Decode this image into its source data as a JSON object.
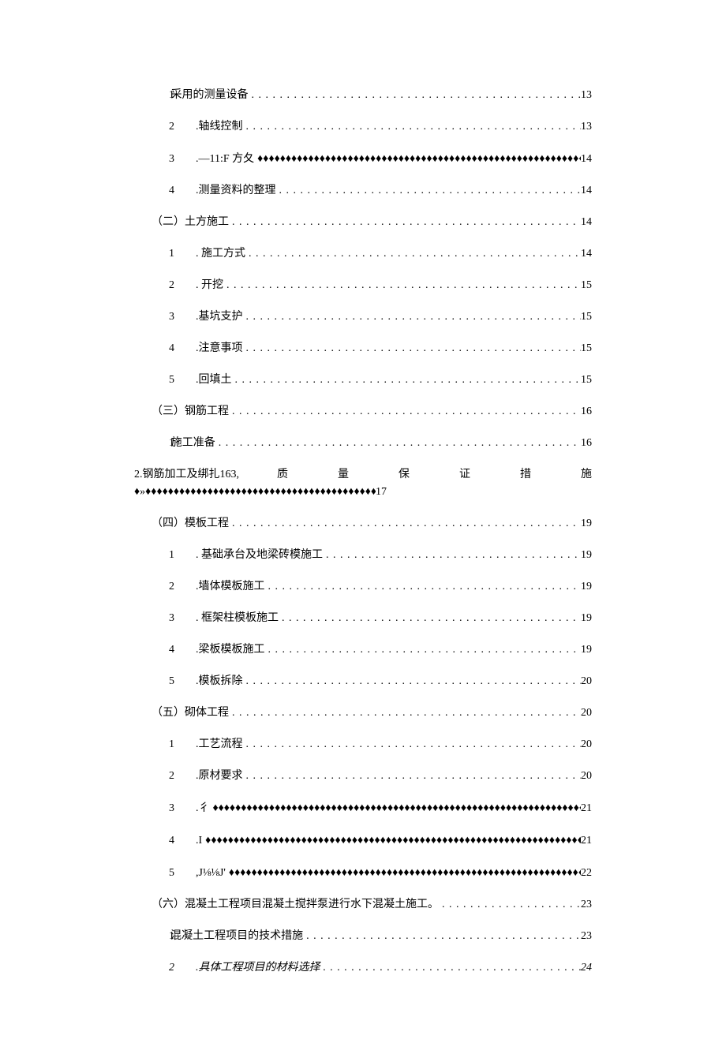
{
  "toc": {
    "items": [
      {
        "indent": 1,
        "num": "1",
        "label": "采用的测量设备",
        "fill": "dot",
        "page": "13",
        "numstyle": "wide"
      },
      {
        "indent": 1,
        "num": "2",
        "label": ".轴线控制",
        "fill": "dot",
        "page": "13"
      },
      {
        "indent": 1,
        "num": "3",
        "label": ".—11:F 方夂",
        "fill": "diamond",
        "page": "14"
      },
      {
        "indent": 1,
        "num": "4",
        "label": ".测量资料的整理",
        "fill": "dot",
        "page": "14"
      },
      {
        "indent": 2,
        "num": "",
        "label": "（二）土方施工",
        "fill": "dot",
        "page": "14",
        "numstyle": "wide"
      },
      {
        "indent": 1,
        "num": "1",
        "label": ". 施工方式",
        "fill": "dot",
        "page": "14"
      },
      {
        "indent": 1,
        "num": "2",
        "label": ". 开挖",
        "fill": "dot",
        "page": "15"
      },
      {
        "indent": 1,
        "num": "3",
        "label": ".基坑支护",
        "fill": "dot",
        "page": "15"
      },
      {
        "indent": 1,
        "num": "4",
        "label": ".注意事项",
        "fill": "dot",
        "page": "15"
      },
      {
        "indent": 1,
        "num": "5",
        "label": ".回填土",
        "fill": "dot",
        "page": "15"
      },
      {
        "indent": 2,
        "num": "",
        "label": "（三）钢筋工程",
        "fill": "dot",
        "page": "16",
        "numstyle": "wide"
      },
      {
        "indent": 1,
        "num": "1",
        "label": "施工准备",
        "fill": "dot",
        "page": "16",
        "numstyle": "wide"
      }
    ],
    "block": {
      "prefix": "2.钢筋加工及绑扎163,",
      "spread": "质量保证措施",
      "prefix2": "♦»",
      "page": "17"
    },
    "items2": [
      {
        "indent": 2,
        "num": "",
        "label": "（四）模板工程",
        "fill": "dot",
        "page": "19",
        "numstyle": "wide"
      },
      {
        "indent": 1,
        "num": "1",
        "label": ". 基础承台及地梁砖模施工",
        "fill": "dot",
        "page": "19"
      },
      {
        "indent": 1,
        "num": "2",
        "label": ".墙体模板施工",
        "fill": "dot",
        "page": "19"
      },
      {
        "indent": 1,
        "num": "3",
        "label": ". 框架柱模板施工",
        "fill": "dot",
        "page": "19"
      },
      {
        "indent": 1,
        "num": "4",
        "label": ".梁板模板施工",
        "fill": "dot",
        "page": "19"
      },
      {
        "indent": 1,
        "num": "5",
        "label": ".模板拆除",
        "fill": "dot",
        "page": "20"
      },
      {
        "indent": 2,
        "num": "",
        "label": "（五）砌体工程",
        "fill": "dot",
        "page": "20",
        "numstyle": "wide"
      },
      {
        "indent": 1,
        "num": "1",
        "label": ".工艺流程",
        "fill": "dot",
        "page": "20"
      },
      {
        "indent": 1,
        "num": "2",
        "label": ".原材要求",
        "fill": "dot",
        "page": "20"
      },
      {
        "indent": 1,
        "num": "3",
        "label": ".彳",
        "fill": "diamond",
        "page": "21"
      },
      {
        "indent": 1,
        "num": "4",
        "label": ".I",
        "fill": "diamond",
        "page": "21"
      },
      {
        "indent": 1,
        "num": "5",
        "label": ",J⅛⅛J'",
        "fill": "diamond",
        "page": "22"
      },
      {
        "indent": 2,
        "num": "",
        "label": "（六）混凝土工程项目混凝土搅拌泵进行水下混凝土施工。",
        "fill": "dot",
        "page": "23",
        "numstyle": "wide"
      },
      {
        "indent": 1,
        "num": "1",
        "label": "混凝土工程项目的技术措施",
        "fill": "dot",
        "page": "23",
        "numstyle": "wide"
      },
      {
        "indent": 1,
        "num": "2",
        "label": ".具体工程项目的材料选择",
        "fill": "dot",
        "page": "24",
        "italic": true
      }
    ]
  },
  "fills": {
    "dot": " . . . . . . . . . . . . . . . . . . . . . . . . . . . . . . . . . . . . . . . . . . . . . . . . . . . . . . . . . . . . . . . . . . . . . . . . . . . . . . . . . . . . . . . . . . . . . . . . . . . . . . . . . . . . . . . . . . . . . . . . . . . . . . . .",
    "diamond": "♦♦♦♦♦♦♦♦♦♦♦♦♦♦♦♦♦♦♦♦♦♦♦♦♦♦♦♦♦♦♦♦♦♦♦♦♦♦♦♦♦♦♦♦♦♦♦♦♦♦♦♦♦♦♦♦♦♦♦♦♦♦♦♦♦♦♦♦♦♦♦♦♦♦♦♦♦♦♦♦♦♦♦♦♦♦♦♦♦♦♦♦♦♦♦♦♦♦♦♦♦♦♦♦♦♦♦♦♦♦♦♦♦♦♦♦♦♦♦♦♦♦♦♦♦♦♦♦"
  }
}
